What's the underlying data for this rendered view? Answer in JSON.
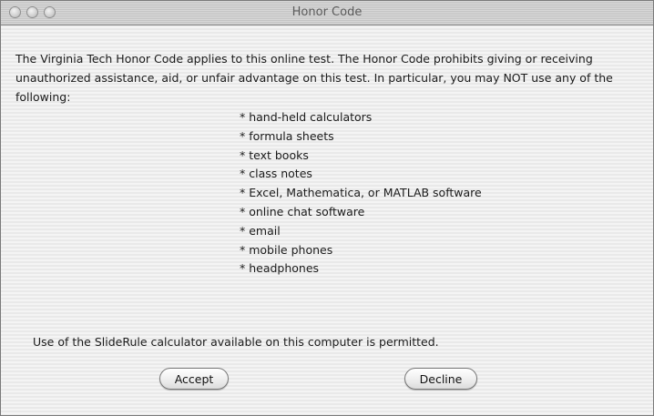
{
  "window": {
    "title": "Honor Code"
  },
  "content": {
    "intro_text": "The Virginia Tech Honor Code applies to this online test.  The Honor Code prohibits giving or receiving unauthorized assistance, aid, or unfair advantage on this test.  In particular, you may NOT use any of the following:",
    "prohibited_items": [
      "* hand-held calculators",
      "* formula sheets",
      "* text books",
      "* class notes",
      "* Excel, Mathematica, or MATLAB software",
      "* online chat software",
      "* email",
      "* mobile phones",
      "* headphones"
    ],
    "permitted_text": "Use of the SlideRule calculator available on this computer is permitted."
  },
  "buttons": {
    "accept_label": "Accept",
    "decline_label": "Decline"
  }
}
